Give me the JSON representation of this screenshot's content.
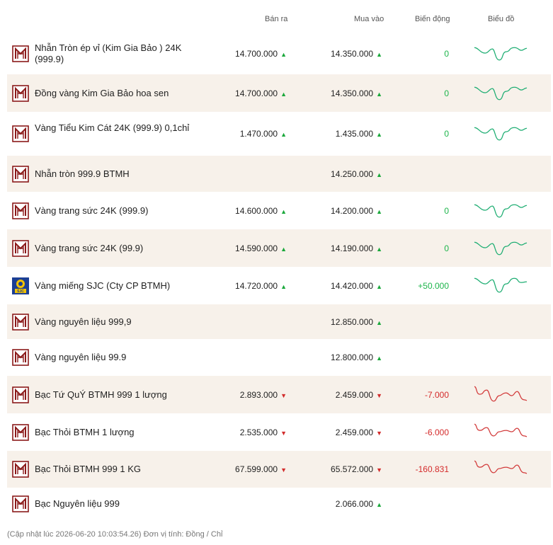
{
  "header": {
    "sell": "Bán ra",
    "buy": "Mua vào",
    "change": "Biến động",
    "chart": "Biểu đồ"
  },
  "rows": [
    {
      "name": "Nhẫn Tròn ép vỉ (Kim Gia Bảo ) 24K (999.9)",
      "sell": "14.700.000",
      "sell_dir": "up",
      "buy": "14.350.000",
      "buy_dir": "up",
      "change": "0",
      "change_dir": "up",
      "chart": "up",
      "logo": "btmh-logo-icon"
    },
    {
      "name": "Đồng vàng Kim Gia Bảo hoa sen",
      "sell": "14.700.000",
      "sell_dir": "up",
      "buy": "14.350.000",
      "buy_dir": "up",
      "change": "0",
      "change_dir": "up",
      "chart": "up",
      "logo": "btmh-logo-icon"
    },
    {
      "name": "Vàng Tiểu Kim Cát 24K (999.9) 0,1chỉ",
      "sell": "1.470.000",
      "sell_dir": "up",
      "buy": "1.435.000",
      "buy_dir": "up",
      "change": "0",
      "change_dir": "up",
      "chart": "up",
      "logo": "btmh-logo-icon"
    },
    {
      "name": "Nhẫn tròn 999.9 BTMH",
      "sell": "",
      "sell_dir": "",
      "buy": "14.250.000",
      "buy_dir": "up",
      "change": "",
      "change_dir": "",
      "chart": "",
      "logo": "btmh-logo-icon"
    },
    {
      "name": "Vàng trang sức 24K (999.9)",
      "sell": "14.600.000",
      "sell_dir": "up",
      "buy": "14.200.000",
      "buy_dir": "up",
      "change": "0",
      "change_dir": "up",
      "chart": "up",
      "logo": "btmh-logo-icon"
    },
    {
      "name": "Vàng trang sức 24K (99.9)",
      "sell": "14.590.000",
      "sell_dir": "up",
      "buy": "14.190.000",
      "buy_dir": "up",
      "change": "0",
      "change_dir": "up",
      "chart": "up",
      "logo": "btmh-logo-icon"
    },
    {
      "name": "Vàng miếng SJC (Cty CP BTMH)",
      "sell": "14.720.000",
      "sell_dir": "up",
      "buy": "14.420.000",
      "buy_dir": "up",
      "change": "+50.000",
      "change_dir": "up",
      "chart": "up",
      "logo": "sjc-logo-icon"
    },
    {
      "name": "Vàng nguyên liệu 999,9",
      "sell": "",
      "sell_dir": "",
      "buy": "12.850.000",
      "buy_dir": "up",
      "change": "",
      "change_dir": "",
      "chart": "",
      "logo": "btmh-logo-icon"
    },
    {
      "name": "Vàng nguyên liệu 99.9",
      "sell": "",
      "sell_dir": "",
      "buy": "12.800.000",
      "buy_dir": "up",
      "change": "",
      "change_dir": "",
      "chart": "",
      "logo": "btmh-logo-icon"
    },
    {
      "name": "Bạc Tứ QuÝ BTMH 999 1 lượng",
      "sell": "2.893.000",
      "sell_dir": "down",
      "buy": "2.459.000",
      "buy_dir": "down",
      "change": "-7.000",
      "change_dir": "down",
      "chart": "down",
      "logo": "btmh-logo-icon"
    },
    {
      "name": "Bạc Thỏi BTMH 1 lượng",
      "sell": "2.535.000",
      "sell_dir": "down",
      "buy": "2.459.000",
      "buy_dir": "down",
      "change": "-6.000",
      "change_dir": "down",
      "chart": "down",
      "logo": "btmh-logo-icon"
    },
    {
      "name": "Bạc Thỏi BTMH 999 1 KG",
      "sell": "67.599.000",
      "sell_dir": "down",
      "buy": "65.572.000",
      "buy_dir": "down",
      "change": "-160.831",
      "change_dir": "down",
      "chart": "down",
      "logo": "btmh-logo-icon"
    },
    {
      "name": "Bạc Nguyên liệu 999",
      "sell": "",
      "sell_dir": "",
      "buy": "2.066.000",
      "buy_dir": "up",
      "change": "",
      "change_dir": "",
      "chart": "",
      "logo": "btmh-logo-icon"
    }
  ],
  "footer": "(Cập nhật lúc 2026-06-20 10:03:54.26)   Đơn vị tính: Đồng / Chỉ",
  "colors": {
    "up": "#1aa83b",
    "down": "#d22b2b",
    "alt_row": "#f7f1ea",
    "brand": "#8b1a1a",
    "sjc_blue": "#1c3f94",
    "sjc_yellow": "#f2c200"
  }
}
